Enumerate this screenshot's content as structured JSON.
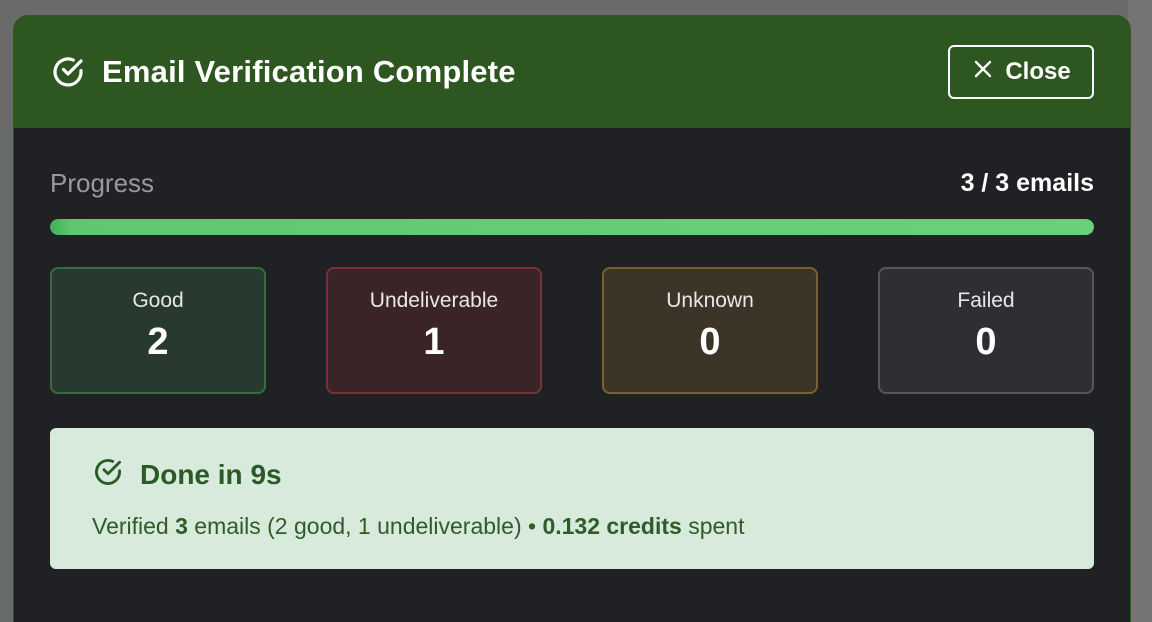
{
  "modal": {
    "title": "Email Verification Complete",
    "close_label": "Close"
  },
  "progress": {
    "label": "Progress",
    "count_text": "3 / 3 emails",
    "fraction": 1.0
  },
  "stats": [
    {
      "label": "Good",
      "value": "2"
    },
    {
      "label": "Undeliverable",
      "value": "1"
    },
    {
      "label": "Unknown",
      "value": "0"
    },
    {
      "label": "Failed",
      "value": "0"
    }
  ],
  "done": {
    "title": "Done in 9s",
    "summary_prefix": "Verified ",
    "summary_count": "3",
    "summary_middle": " emails (2 good, 1 undeliverable) • ",
    "summary_credits": "0.132 credits",
    "summary_suffix": " spent"
  },
  "colors": {
    "header_bg": "#2d5620",
    "progress_fill": "#6ad178",
    "done_bg": "#d7eadb",
    "done_text": "#2a5a26"
  },
  "icons": {
    "title": "check-circle-icon",
    "close": "close-icon",
    "done": "check-circle-icon"
  }
}
